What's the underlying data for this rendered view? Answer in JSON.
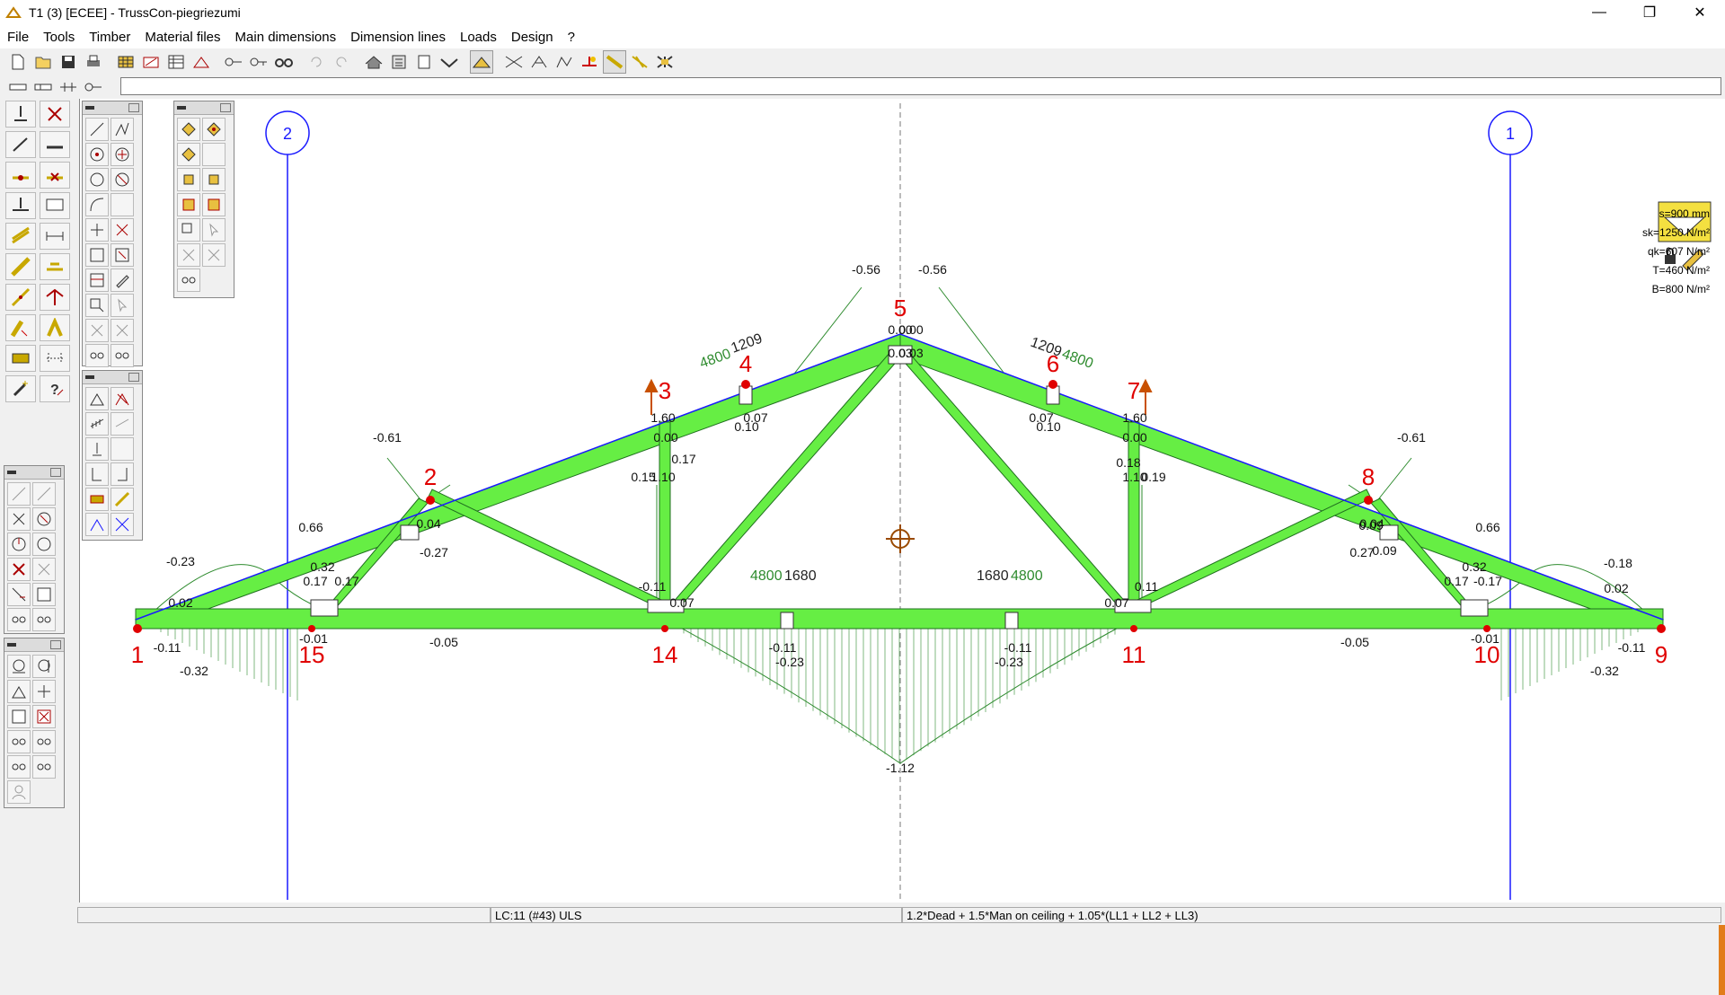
{
  "window": {
    "title": "T1 (3) [ECEE] - TrussCon-piegriezumi",
    "controls": [
      "—",
      "❐",
      "✕"
    ]
  },
  "menu": [
    "File",
    "Tools",
    "Timber",
    "Material files",
    "Main dimensions",
    "Dimension lines",
    "Loads",
    "Design",
    "?"
  ],
  "command_input": {
    "value": ""
  },
  "params": {
    "s": "s=900 mm",
    "sk": "sk=1250 N/m²",
    "qk": "qk=607 N/m²",
    "T": "T=460 N/m²",
    "B": "B=800 N/m²"
  },
  "axes": [
    {
      "label": "2"
    },
    {
      "label": "1"
    }
  ],
  "node_numbers": [
    "1",
    "2",
    "3",
    "4",
    "5",
    "6",
    "7",
    "8",
    "9",
    "10",
    "11",
    "14",
    "15"
  ],
  "dimension_labels": [
    "4800",
    "1209",
    "1209",
    "4800",
    "4800",
    "1680",
    "1680",
    "4800"
  ],
  "moment_values": [
    "-0.56",
    "-0.56",
    "0.00",
    "0.00",
    "0.03",
    "0.03",
    "-0.61",
    "-0.61",
    "1.60",
    "1.60",
    "0.00",
    "0.00",
    "0.17",
    "1.10",
    "0.15",
    "0.07",
    "0.10",
    "0.07",
    "0.10",
    "0.18",
    "1.10",
    "0.19",
    "0.66",
    "0.66",
    "0.04",
    "0.04",
    "0.09",
    "-0.27",
    "0.27",
    "0.09",
    "-0.23",
    "-0.18",
    "0.02",
    "0.02",
    "0.32",
    "0.32",
    "0.17",
    "0.17",
    "0.17",
    "-0.17",
    "-0.11",
    "0.07",
    "0.11",
    "0.07",
    "-0.01",
    "-0.01",
    "-0.05",
    "-0.05",
    "-0.11",
    "-0.11",
    "-0.32",
    "-0.32",
    "-0.11",
    "-0.11",
    "-0.23",
    "-0.23",
    "-1.12"
  ],
  "status": {
    "left": "",
    "load_case": "LC:11 (#43) ULS",
    "combination": "1.2*Dead + 1.5*Man on ceiling + 1.05*(LL1 + LL2 + LL3)"
  },
  "colors": {
    "member_fill": "#66ee44",
    "member_edge": "#2a8a2a",
    "diagram": "#2e8b2e",
    "axis": "#1a1aff",
    "node": "#e00000",
    "node_label": "#e00000"
  }
}
